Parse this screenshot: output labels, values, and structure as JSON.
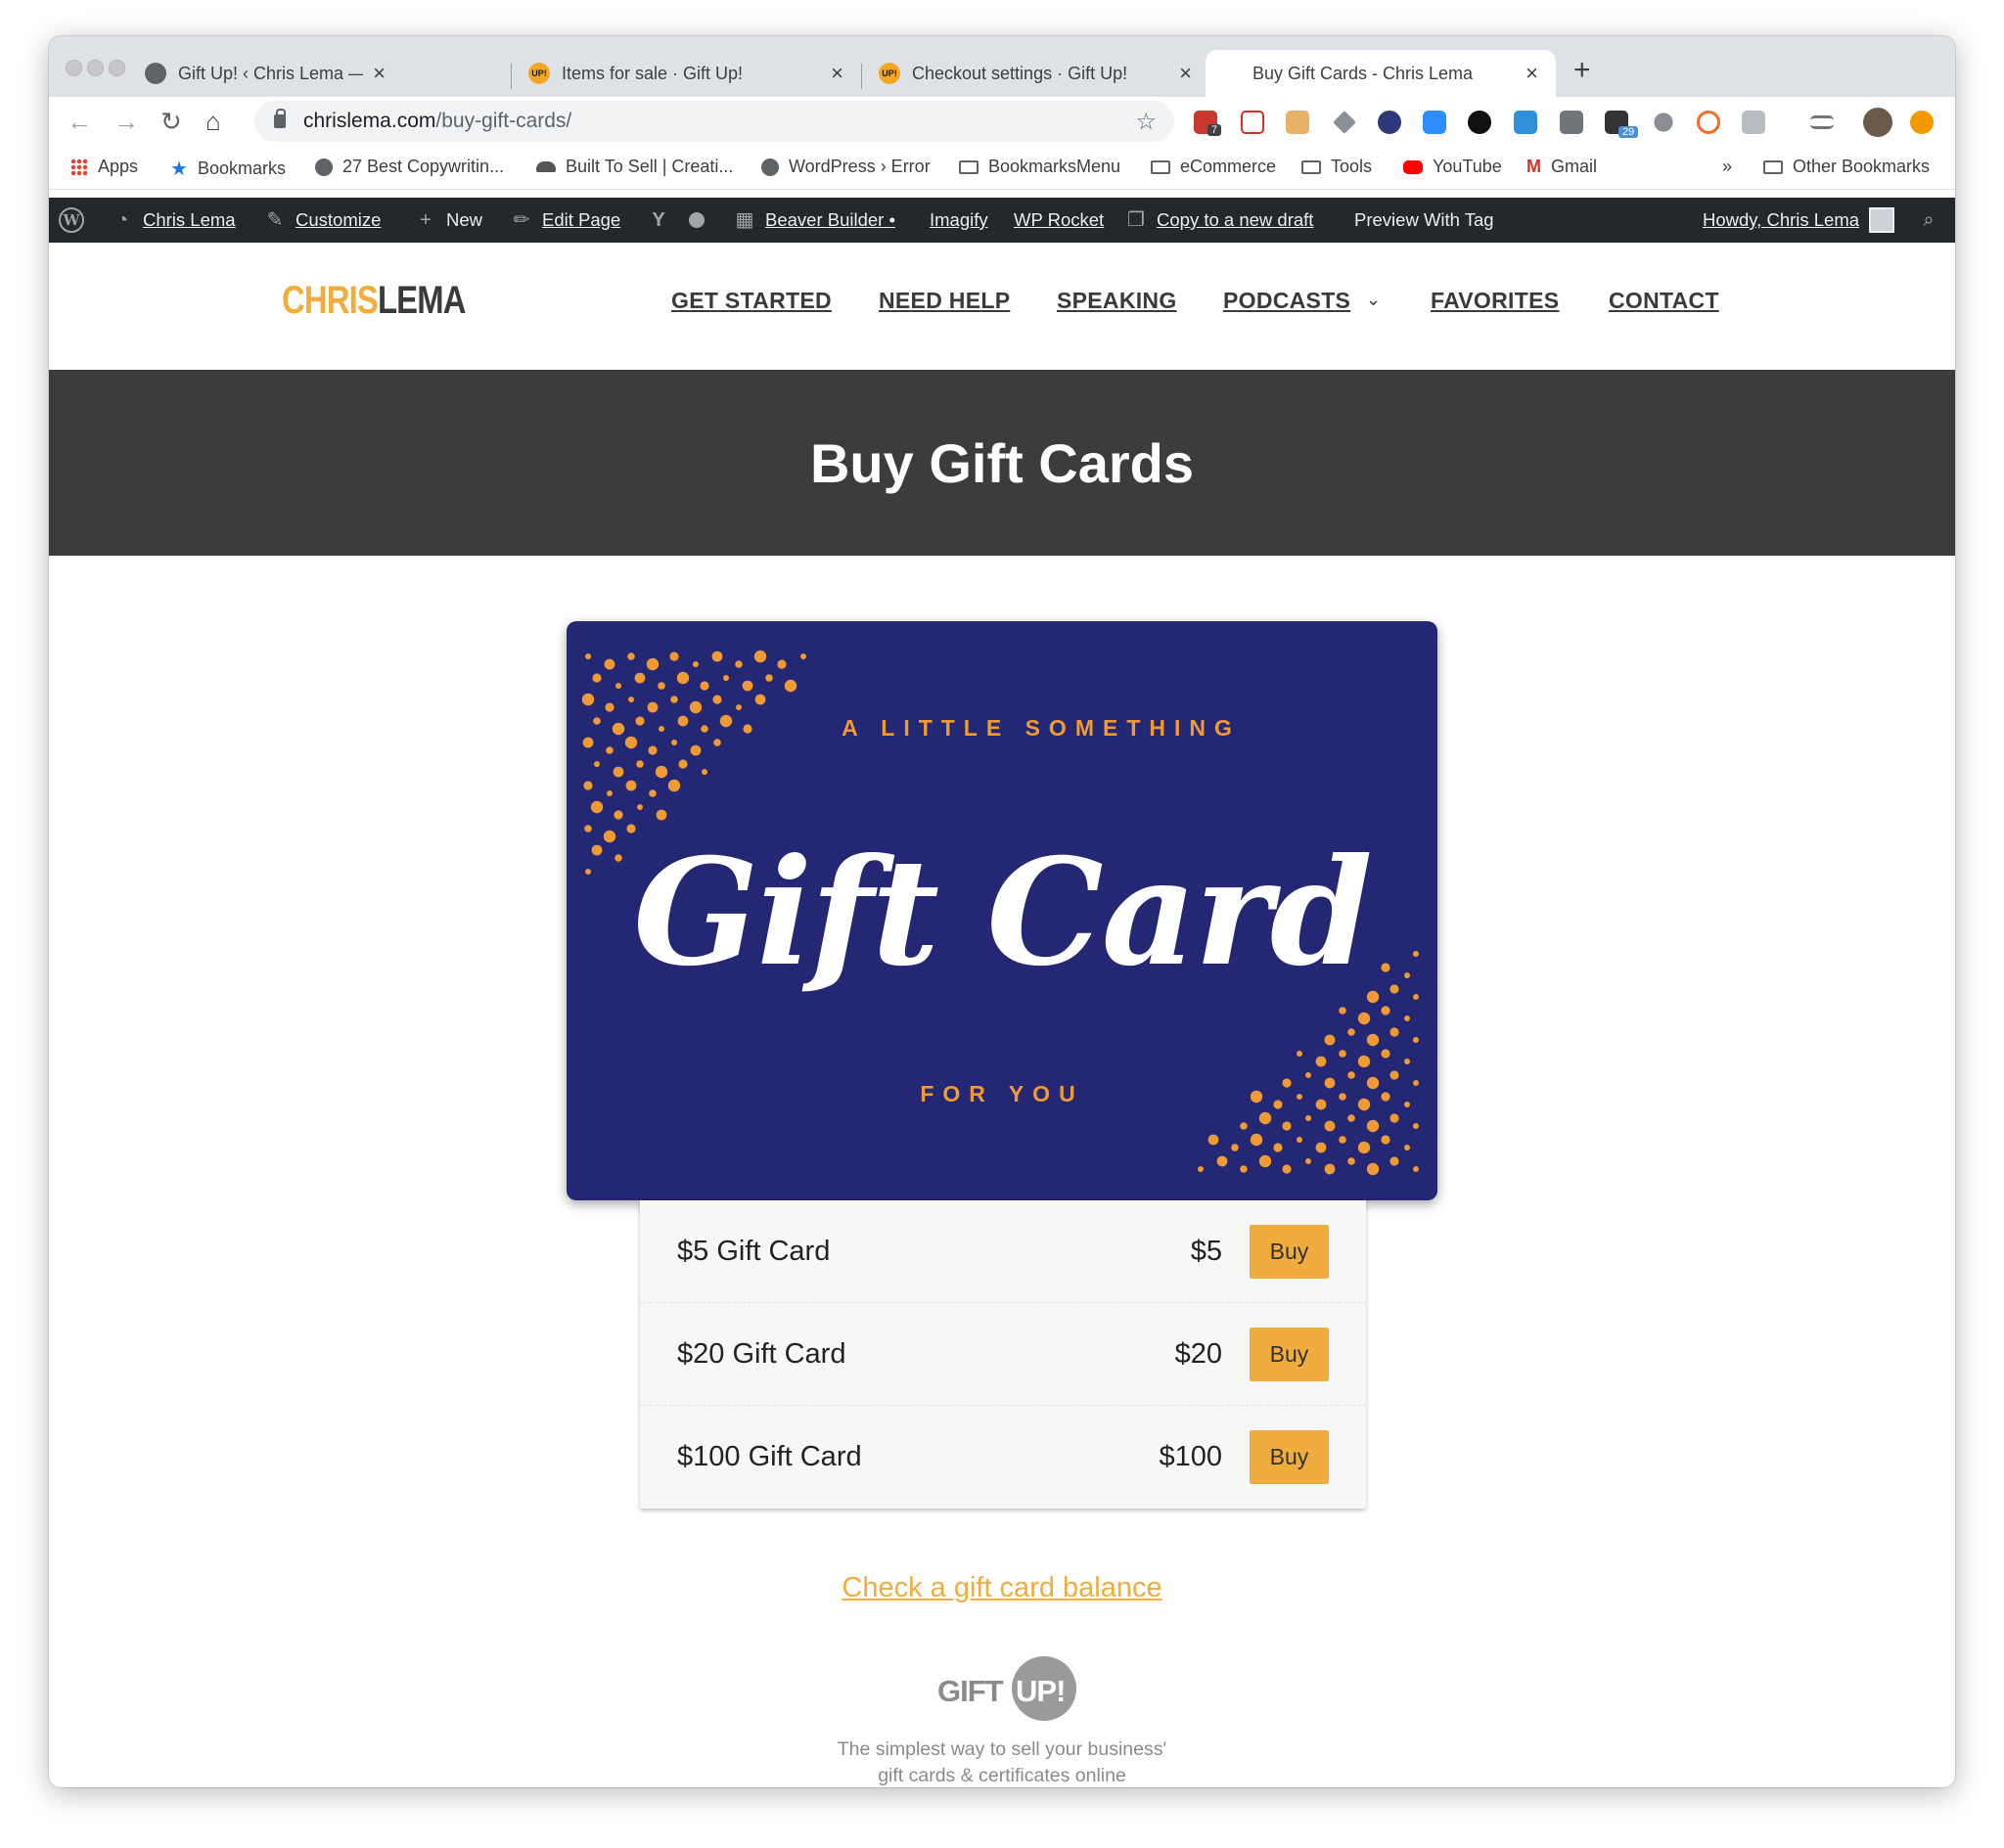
{
  "tabs": [
    {
      "title": "Gift Up! ‹ Chris Lema — WordPress",
      "favicon": "globe-icon"
    },
    {
      "title": "Items for sale · Gift Up!",
      "favicon": "giftup-icon"
    },
    {
      "title": "Checkout settings · Gift Up!",
      "favicon": "giftup-icon"
    },
    {
      "title": "Buy Gift Cards - Chris Lema",
      "favicon": ""
    }
  ],
  "address": {
    "domain": "chrislema.com",
    "path": "/buy-gift-cards/"
  },
  "extension_badges": {
    "first": "7",
    "second": "29"
  },
  "bookmarks": [
    {
      "label": "Apps",
      "icon": "apps-grid-icon"
    },
    {
      "label": "Bookmarks",
      "icon": "star-icon"
    },
    {
      "label": "27 Best Copywritin...",
      "icon": "globe-icon"
    },
    {
      "label": "Built To Sell | Creati...",
      "icon": "car-icon"
    },
    {
      "label": "WordPress › Error",
      "icon": "globe-icon"
    },
    {
      "label": "BookmarksMenu",
      "icon": "folder-icon"
    },
    {
      "label": "eCommerce",
      "icon": "folder-icon"
    },
    {
      "label": "Tools",
      "icon": "folder-icon"
    },
    {
      "label": "YouTube",
      "icon": "youtube-icon"
    },
    {
      "label": "Gmail",
      "icon": "gmail-icon"
    }
  ],
  "bookmarks_overflow": "»",
  "other_bookmarks": "Other Bookmarks",
  "adminbar": {
    "site": "Chris Lema",
    "customize": "Customize",
    "new": "New",
    "edit_page": "Edit Page",
    "beaver_builder": "Beaver Builder •",
    "imagify": "Imagify",
    "wp_rocket": "WP Rocket",
    "copy_draft": "Copy to a new draft",
    "preview": "Preview With Tag",
    "howdy": "Howdy, Chris Lema"
  },
  "site": {
    "logo_part1": "CHRIS",
    "logo_part2": "LEMA",
    "nav": [
      "GET STARTED",
      "NEED HELP",
      "SPEAKING",
      "PODCASTS",
      "FAVORITES",
      "CONTACT"
    ]
  },
  "hero": {
    "title": "Buy Gift Cards"
  },
  "giftcard": {
    "top_text": "A LITTLE SOMETHING",
    "main_text": "Gift Card",
    "bottom_text": "FOR YOU",
    "background_color": "#242773",
    "accent_color": "#f09a34"
  },
  "products": [
    {
      "name": "$5 Gift Card",
      "price": "$5",
      "button": "Buy"
    },
    {
      "name": "$20 Gift Card",
      "price": "$20",
      "button": "Buy"
    },
    {
      "name": "$100 Gift Card",
      "price": "$100",
      "button": "Buy"
    }
  ],
  "balance_link": "Check a gift card balance",
  "giftup": {
    "logo_part1": "GIFT",
    "logo_part2": "UP!",
    "tagline_line1": "The simplest way to sell your business'",
    "tagline_line2": "gift cards & certificates online"
  },
  "colors": {
    "accent": "#f0ad3e",
    "hero_bg": "#3c3c3e",
    "adminbar_bg": "#23282d"
  }
}
